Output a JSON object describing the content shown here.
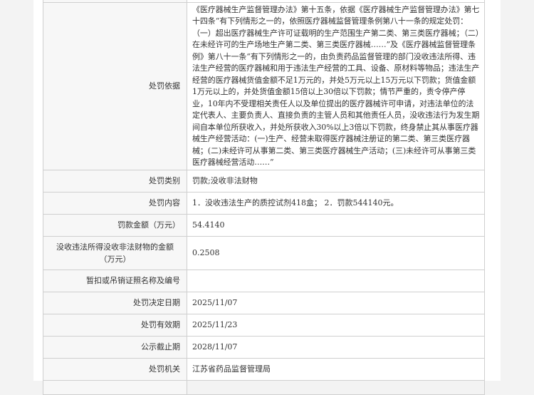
{
  "rows": [
    {
      "label": "",
      "value": ""
    },
    {
      "label": "处罚依据",
      "value": "《医疗器械生产监督管理办法》第十五条，依据《医疗器械生产监督管理办法》第七十四条“有下列情形之一的，依照医疗器械监督管理条例第八十一条的规定处罚：（一）超出医疗器械生产许可证载明的生产范围生产第二类、第三类医疗器械；（二）在未经许可的生产场地生产第二类、第三类医疗器械……”及《医疗器械监督管理条例》第八十一条“有下列情形之一的，由负责药品监督管理的部门没收违法所得、违法生产经营的医疗器械和用于违法生产经营的工具、设备、原材料等物品；违法生产经营的医疗器械货值金额不足1万元的，并处5万元以上15万元以下罚款；货值金额1万元以上的，并处货值金额15倍以上30倍以下罚款；情节严重的，责令停产停业，10年内不受理相关责任人以及单位提出的医疗器械许可申请，对违法单位的法定代表人、主要负责人、直接负责的主管人员和其他责任人员，没收违法行为发生期间自本单位所获收入，并处所获收入30%以上3倍以下罚款，终身禁止其从事医疗器械生产经营活动：(一)生产、经营未取得医疗器械注册证的第二类、第三类医疗器械；(二)未经许可从事第二类、第三类医疗器械生产活动；(三)未经许可从事第三类医疗器械经营活动……”"
    },
    {
      "label": "处罚类别",
      "value": "罚款;没收非法财物"
    },
    {
      "label": "处罚内容",
      "value": "1．没收违法生产的质控试剂418盒；  2．罚款544140元。"
    },
    {
      "label": "罚款金额（万元）",
      "value": "54.4140"
    },
    {
      "label": "没收违法所得没收非法财物的金额（万元）",
      "value": "0.2508"
    },
    {
      "label": "暂扣或吊销证照名称及编号",
      "value": ""
    },
    {
      "label": "处罚决定日期",
      "value": "2025/11/07"
    },
    {
      "label": "处罚有效期",
      "value": "2025/11/23"
    },
    {
      "label": "公示截止期",
      "value": "2028/11/07"
    },
    {
      "label": "处罚机关",
      "value": "江苏省药品监督管理局"
    },
    {
      "label": "",
      "value": ""
    }
  ]
}
